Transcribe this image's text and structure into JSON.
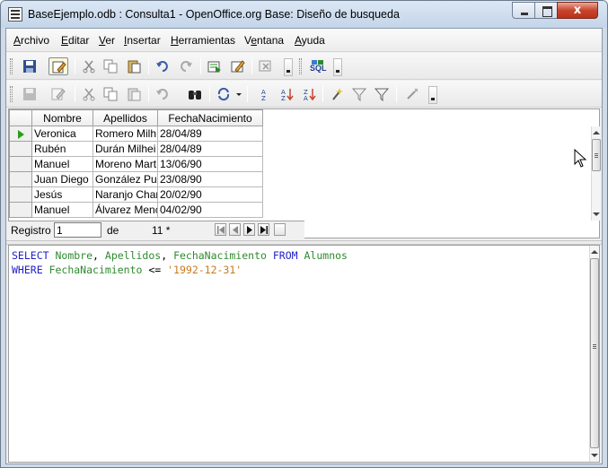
{
  "window": {
    "title": "BaseEjemplo.odb : Consulta1 - OpenOffice.org Base: Diseño de busqueda",
    "close_glyph": "x"
  },
  "menu": [
    {
      "first": "A",
      "rest": "rchivo"
    },
    {
      "first": "E",
      "rest": "ditar"
    },
    {
      "first": "V",
      "rest": "er"
    },
    {
      "first": "I",
      "rest": "nsertar"
    },
    {
      "first": "H",
      "rest": "erramientas"
    },
    {
      "first": "",
      "pre": "V",
      "mid": "e",
      "rest": "ntana"
    },
    {
      "first": "A",
      "rest": "yuda"
    }
  ],
  "menu_labels": [
    "Archivo",
    "Editar",
    "Ver",
    "Insertar",
    "Herramientas",
    "Ventana",
    "Ayuda"
  ],
  "toolbar1": {
    "icons": [
      "save-icon",
      "edit-mode-icon",
      "cut-icon",
      "copy-icon",
      "paste-icon",
      "undo-icon",
      "redo-icon",
      "run-query-icon",
      "design-view-icon",
      "clear-query-icon",
      "sql-icon"
    ],
    "sql_label": "SQL"
  },
  "toolbar2": {
    "icons": [
      "save-record-icon",
      "edit-data-icon",
      "cut-icon",
      "copy-icon",
      "paste-icon",
      "undo-icon",
      "find-icon",
      "refresh-icon",
      "sort-ascending-icon",
      "sort-icon",
      "sort-descending-icon",
      "autofilter-icon",
      "standard-filter-icon",
      "apply-filter-icon",
      "remove-filter-icon"
    ]
  },
  "grid": {
    "columns": [
      "Nombre",
      "Apellidos",
      "FechaNacimiento"
    ],
    "rows": [
      [
        "Veronica",
        "Romero Milh",
        "28/04/89"
      ],
      [
        "Rubén",
        "Durán Milhei",
        "28/04/89"
      ],
      [
        "Manuel",
        "Moreno Mart",
        "13/06/90"
      ],
      [
        "Juan Diego",
        "González Puli",
        "23/08/90"
      ],
      [
        "Jesús",
        "Naranjo Char",
        "20/02/90"
      ],
      [
        "Manuel",
        "Álvarez Menc",
        "04/02/90"
      ]
    ],
    "current_row": 0
  },
  "record_nav": {
    "label": "Registro",
    "value": "1",
    "of_label": "de",
    "count": "11 *"
  },
  "sql": {
    "line1": [
      {
        "cls": "kw",
        "text": "SELECT"
      },
      {
        "cls": "op",
        "text": " "
      },
      {
        "cls": "id",
        "text": "Nombre"
      },
      {
        "cls": "op",
        "text": ", "
      },
      {
        "cls": "id",
        "text": "Apellidos"
      },
      {
        "cls": "op",
        "text": ", "
      },
      {
        "cls": "id",
        "text": "FechaNacimiento"
      },
      {
        "cls": "op",
        "text": " "
      },
      {
        "cls": "kw",
        "text": "FROM"
      },
      {
        "cls": "op",
        "text": " "
      },
      {
        "cls": "id",
        "text": "Alumnos"
      }
    ],
    "line2": [
      {
        "cls": "kw",
        "text": "WHERE"
      },
      {
        "cls": "op",
        "text": " "
      },
      {
        "cls": "id",
        "text": "FechaNacimiento"
      },
      {
        "cls": "op",
        "text": " <= "
      },
      {
        "cls": "str",
        "text": "'1992-12-31'"
      }
    ]
  },
  "colors": {
    "sql_keyword": "#1f1fc7",
    "sql_identifier": "#2f8a2f",
    "sql_string": "#c87a1d",
    "current_row_marker": "#2d9b1d",
    "close_button": "#c8452d"
  }
}
